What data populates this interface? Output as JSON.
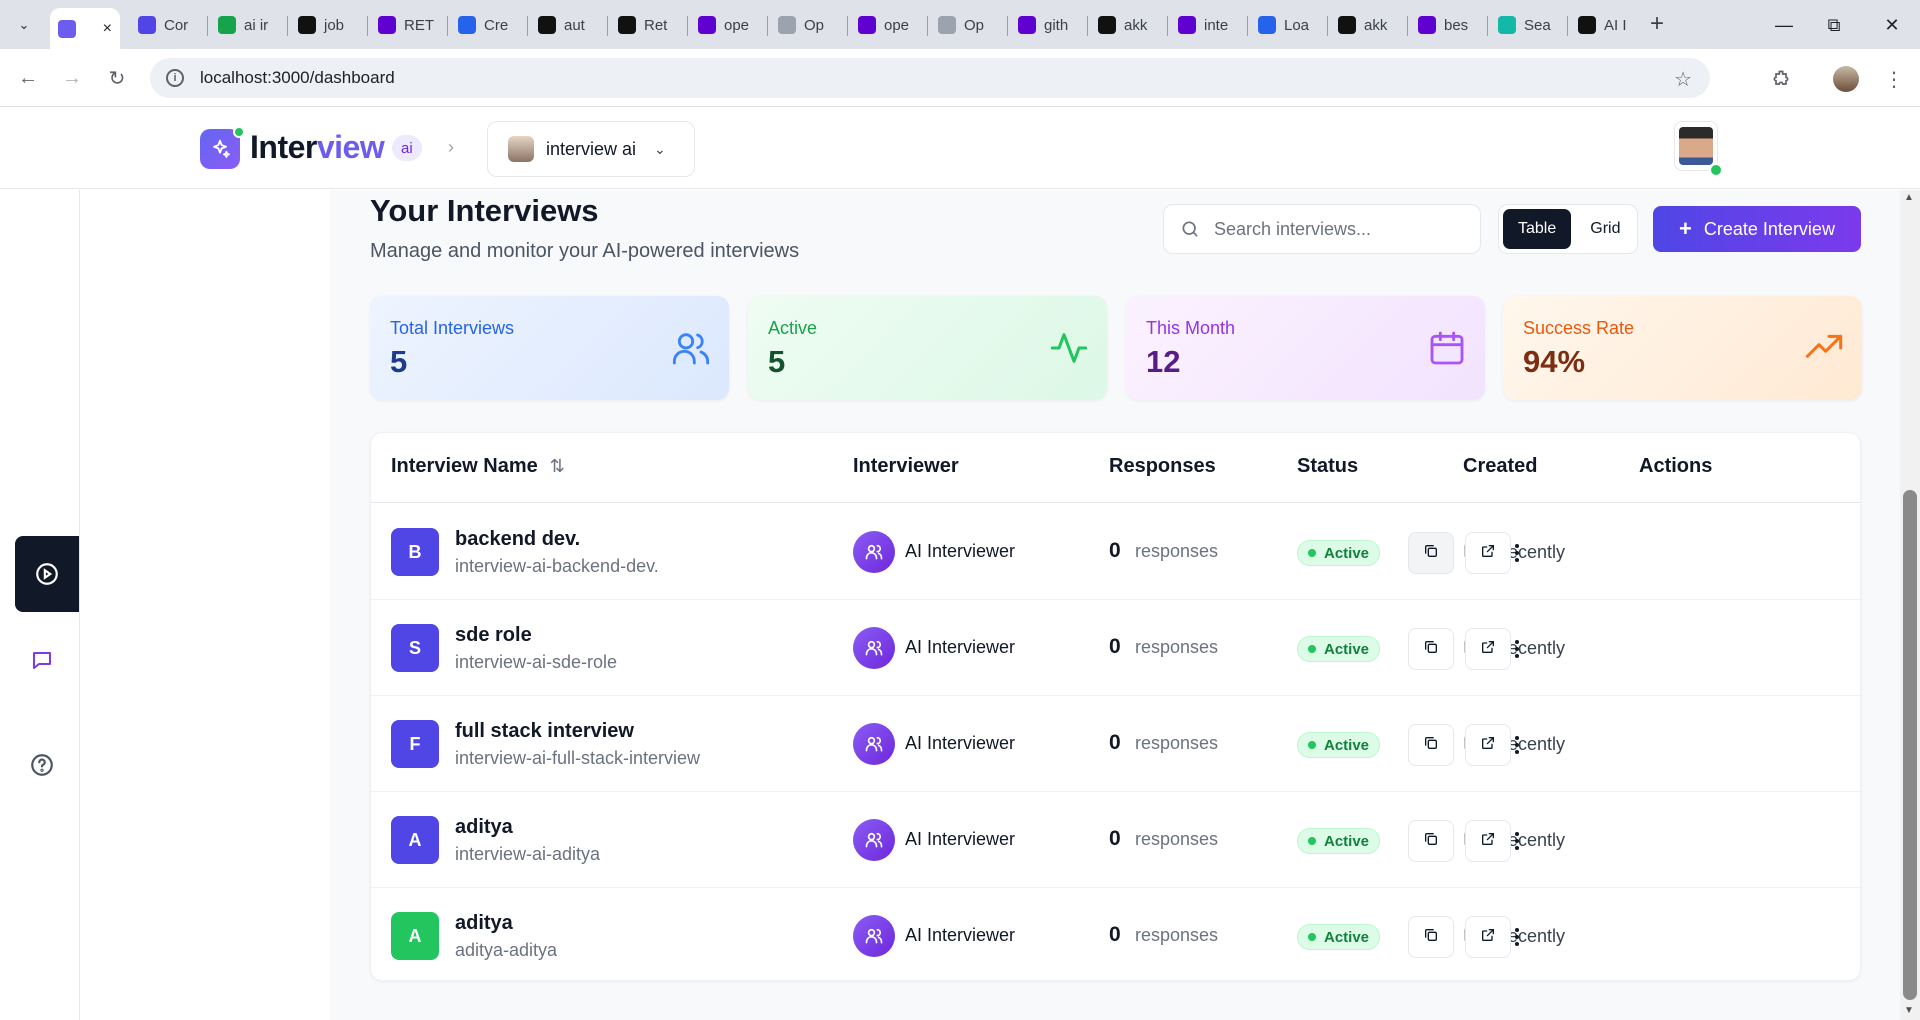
{
  "browser": {
    "tabs": [
      {
        "title": "",
        "icon": "interview-favicon",
        "color": "#6d5cf0",
        "active": true
      },
      {
        "title": "Cor",
        "icon": "c-favicon",
        "color": "#4f46e5"
      },
      {
        "title": "ai ir",
        "icon": "bolt-favicon",
        "color": "#16a34a"
      },
      {
        "title": "job",
        "icon": "triangle-favicon",
        "color": "#111111"
      },
      {
        "title": "RET",
        "icon": "y-favicon",
        "color": "#6001d2"
      },
      {
        "title": "Cre",
        "icon": "dots-favicon",
        "color": "#2563eb"
      },
      {
        "title": "aut",
        "icon": "grid-favicon",
        "color": "#111111"
      },
      {
        "title": "Ret",
        "icon": "grid-favicon",
        "color": "#111111"
      },
      {
        "title": "ope",
        "icon": "y-favicon",
        "color": "#6001d2"
      },
      {
        "title": "Op",
        "icon": "share-favicon",
        "color": "#9ca3af"
      },
      {
        "title": "ope",
        "icon": "y-favicon",
        "color": "#6001d2"
      },
      {
        "title": "Op",
        "icon": "share-favicon",
        "color": "#9ca3af"
      },
      {
        "title": "gith",
        "icon": "y-favicon",
        "color": "#6001d2"
      },
      {
        "title": "akk",
        "icon": "github-favicon",
        "color": "#111111"
      },
      {
        "title": "inte",
        "icon": "y-favicon",
        "color": "#6001d2"
      },
      {
        "title": "Loa",
        "icon": "doc-favicon",
        "color": "#2563eb"
      },
      {
        "title": "akk",
        "icon": "github-favicon",
        "color": "#111111"
      },
      {
        "title": "bes",
        "icon": "y-favicon",
        "color": "#6001d2"
      },
      {
        "title": "Sea",
        "icon": "v-favicon",
        "color": "#14b8a6"
      },
      {
        "title": "AI I",
        "icon": "dice-favicon",
        "color": "#111111"
      }
    ],
    "url": "localhost:3000/dashboard"
  },
  "header": {
    "brand_main": "Inter",
    "brand_accent": "view",
    "brand_badge": "ai",
    "org_name": "interview ai"
  },
  "page": {
    "title": "Your Interviews",
    "subtitle": "Manage and monitor your AI-powered interviews",
    "search_placeholder": "Search interviews...",
    "view_toggle": [
      "Table",
      "Grid"
    ],
    "create_label": "Create Interview"
  },
  "stats": [
    {
      "label": "Total Interviews",
      "value": "5",
      "icon": "users-icon"
    },
    {
      "label": "Active",
      "value": "5",
      "icon": "activity-icon"
    },
    {
      "label": "This Month",
      "value": "12",
      "icon": "calendar-icon"
    },
    {
      "label": "Success Rate",
      "value": "94%",
      "icon": "trending-up-icon"
    }
  ],
  "table": {
    "columns": [
      "Interview Name",
      "Interviewer",
      "Responses",
      "Status",
      "Created",
      "Actions"
    ],
    "rows": [
      {
        "initial": "B",
        "name": "backend dev.",
        "slug": "interview-ai-backend-dev.",
        "interviewer": "AI Interviewer",
        "responses": "0",
        "responses_label": "responses",
        "status": "Active",
        "created": "Recently",
        "avatar_color": "#4f46e5"
      },
      {
        "initial": "S",
        "name": "sde role",
        "slug": "interview-ai-sde-role",
        "interviewer": "AI Interviewer",
        "responses": "0",
        "responses_label": "responses",
        "status": "Active",
        "created": "Recently",
        "avatar_color": "#4f46e5"
      },
      {
        "initial": "F",
        "name": "full stack interview",
        "slug": "interview-ai-full-stack-interview",
        "interviewer": "AI Interviewer",
        "responses": "0",
        "responses_label": "responses",
        "status": "Active",
        "created": "Recently",
        "avatar_color": "#4f46e5"
      },
      {
        "initial": "A",
        "name": "aditya",
        "slug": "interview-ai-aditya",
        "interviewer": "AI Interviewer",
        "responses": "0",
        "responses_label": "responses",
        "status": "Active",
        "created": "Recently",
        "avatar_color": "#4f46e5"
      },
      {
        "initial": "A",
        "name": "aditya",
        "slug": "aditya-aditya",
        "interviewer": "AI Interviewer",
        "responses": "0",
        "responses_label": "responses",
        "status": "Active",
        "created": "Recently",
        "avatar_color": "#22c55e"
      }
    ]
  },
  "colors": {
    "accent": "#6d5cf0",
    "primary_button": "#4f46e5",
    "active_status": "#22c55e"
  }
}
